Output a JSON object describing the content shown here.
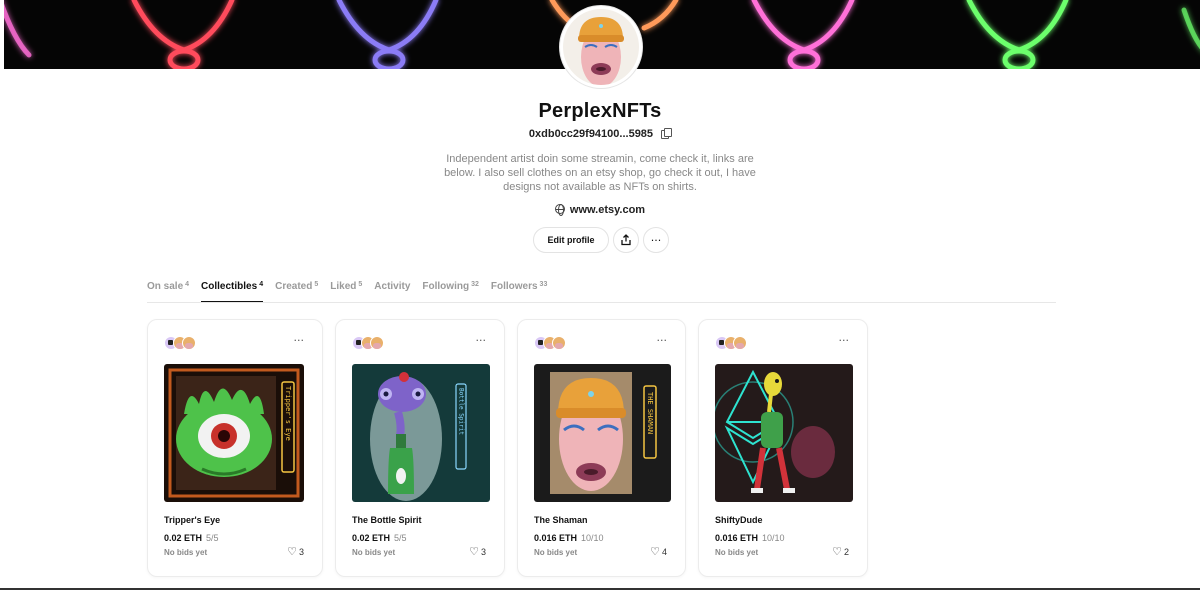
{
  "profile": {
    "name": "PerplexNFTs",
    "address": "0xdb0cc29f94100...5985",
    "bio": "Independent artist doin some streamin, come check it, links are below. I also sell clothes on an etsy shop, go check it out, I have designs not available as NFTs on shirts.",
    "website": "www.etsy.com"
  },
  "actions": {
    "edit_label": "Edit profile",
    "share_icon": "share-icon",
    "more_label": "···"
  },
  "tabs": [
    {
      "label": "On sale",
      "count": "4"
    },
    {
      "label": "Collectibles",
      "count": "4"
    },
    {
      "label": "Created",
      "count": "5"
    },
    {
      "label": "Liked",
      "count": "5"
    },
    {
      "label": "Activity",
      "count": ""
    },
    {
      "label": "Following",
      "count": "32"
    },
    {
      "label": "Followers",
      "count": "33"
    }
  ],
  "active_tab": "Collectibles",
  "cards": [
    {
      "title": "Tripper's Eye",
      "price": "0.02 ETH",
      "edition": "5/5",
      "bids": "No bids yet",
      "likes": "3",
      "more": "···"
    },
    {
      "title": "The Bottle Spirit",
      "price": "0.02 ETH",
      "edition": "5/5",
      "bids": "No bids yet",
      "likes": "3",
      "more": "···"
    },
    {
      "title": "The Shaman",
      "price": "0.016 ETH",
      "edition": "10/10",
      "bids": "No bids yet",
      "likes": "4",
      "more": "···"
    },
    {
      "title": "ShiftyDude",
      "price": "0.016 ETH",
      "edition": "10/10",
      "bids": "No bids yet",
      "likes": "2",
      "more": "···"
    }
  ],
  "art_signs": {
    "trippers_eye": "Tripper's Eye",
    "bottle_spirit": "Bottle Spirit",
    "shaman": "THE SHAMAN"
  },
  "colors": {
    "banner_bg": "#050505",
    "neon_red": "#ff4b5c",
    "neon_purple": "#8b7cf6",
    "neon_orange": "#ff9a5a",
    "neon_pink": "#ff6fd8",
    "neon_green": "#6cff6c"
  }
}
